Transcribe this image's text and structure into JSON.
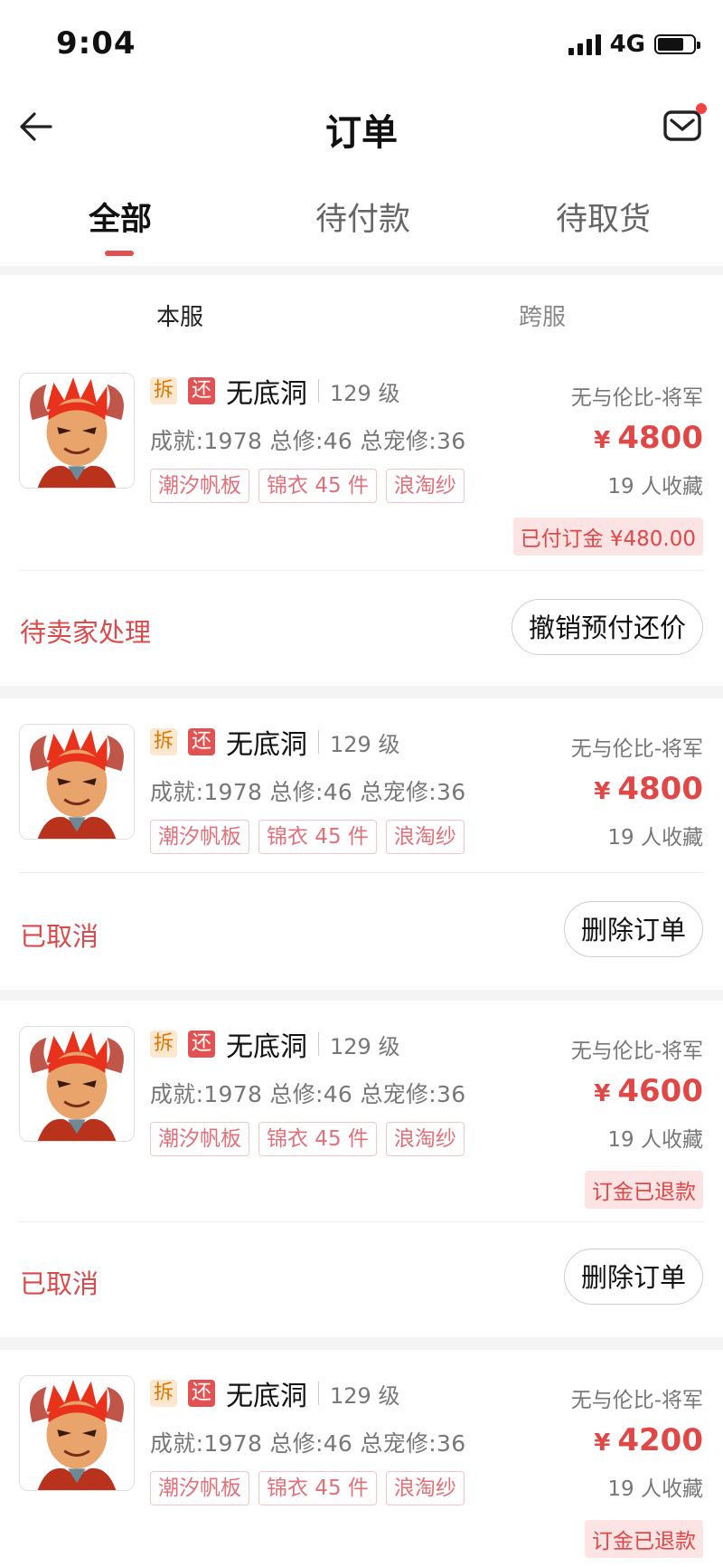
{
  "status_bar": {
    "time": "9:04",
    "network": "4G"
  },
  "nav": {
    "title": "订单"
  },
  "tabs": [
    {
      "label": "全部",
      "active": true
    },
    {
      "label": "待付款",
      "active": false
    },
    {
      "label": "待取货",
      "active": false
    }
  ],
  "subtabs": [
    {
      "label": "本服",
      "active": true
    },
    {
      "label": "跨服",
      "active": false
    }
  ],
  "colors": {
    "accent": "#e04848",
    "tag_chai_bg": "#fde7cf",
    "tag_huan_bg": "#e25252"
  },
  "orders": [
    {
      "tag_chai": "拆",
      "tag_huan": "还",
      "name": "无底洞",
      "level": "129 级",
      "stats": "成就:1978 总修:46 总宠修:36",
      "chips": [
        "潮汐帆板",
        "锦衣 45 件",
        "浪淘纱"
      ],
      "server": "无与伦比-将军",
      "price_symbol": "¥",
      "price": "4800",
      "favs": "19 人收藏",
      "badge": "已付订金 ¥480.00",
      "status": "待卖家处理",
      "action": "撤销预付还价"
    },
    {
      "tag_chai": "拆",
      "tag_huan": "还",
      "name": "无底洞",
      "level": "129 级",
      "stats": "成就:1978 总修:46 总宠修:36",
      "chips": [
        "潮汐帆板",
        "锦衣 45 件",
        "浪淘纱"
      ],
      "server": "无与伦比-将军",
      "price_symbol": "¥",
      "price": "4800",
      "favs": "19 人收藏",
      "status": "已取消",
      "action": "删除订单"
    },
    {
      "tag_chai": "拆",
      "tag_huan": "还",
      "name": "无底洞",
      "level": "129 级",
      "stats": "成就:1978 总修:46 总宠修:36",
      "chips": [
        "潮汐帆板",
        "锦衣 45 件",
        "浪淘纱"
      ],
      "server": "无与伦比-将军",
      "price_symbol": "¥",
      "price": "4600",
      "favs": "19 人收藏",
      "badge": "订金已退款",
      "status": "已取消",
      "action": "删除订单"
    },
    {
      "tag_chai": "拆",
      "tag_huan": "还",
      "name": "无底洞",
      "level": "129 级",
      "stats": "成就:1978 总修:46 总宠修:36",
      "chips": [
        "潮汐帆板",
        "锦衣 45 件",
        "浪淘纱"
      ],
      "server": "无与伦比-将军",
      "price_symbol": "¥",
      "price": "4200",
      "favs": "19 人收藏",
      "badge": "订金已退款"
    }
  ]
}
